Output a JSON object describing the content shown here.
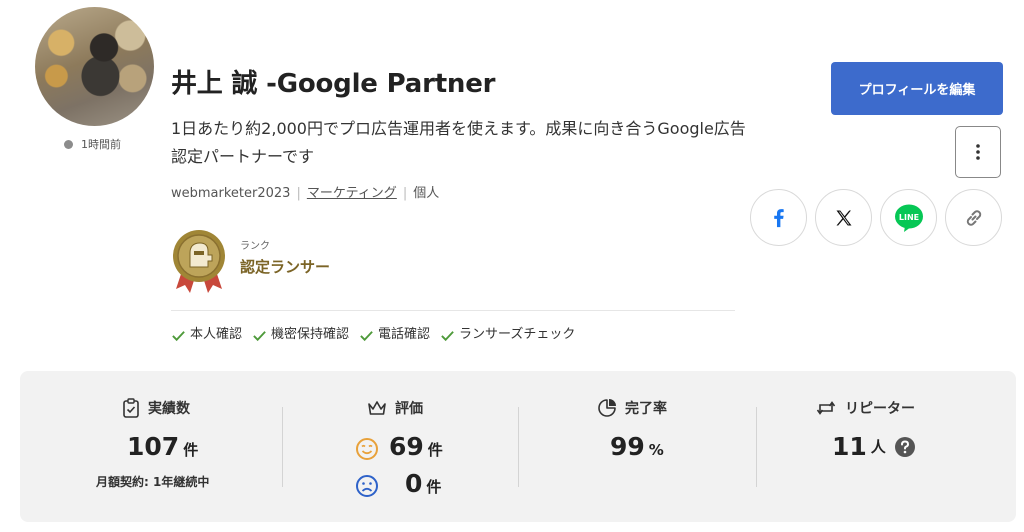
{
  "profile": {
    "name_title": "井上 誠 -Google Partner",
    "catchphrase": "1日あたり約2,000円でプロ広告運用者を使えます。成果に向き合うGoogle広告認定パートナーです",
    "last_login": "1時間前",
    "username": "webmarketer2023",
    "category": "マーケティング",
    "account_type": "個人",
    "rank_label": "ランク",
    "rank_value": "認定ランサー",
    "verifications": [
      "本人確認",
      "機密保持確認",
      "電話確認",
      "ランサーズチェック"
    ]
  },
  "actions": {
    "edit_label": "プロフィールを編集",
    "share_icons": [
      "facebook-icon",
      "x-icon",
      "line-icon",
      "link-icon"
    ],
    "line_text": "LINE"
  },
  "stats": {
    "achievements_label": "実績数",
    "achievements_value": "107",
    "achievements_unit": "件",
    "achievements_sub": "月額契約: 1年継続中",
    "rating_label": "評価",
    "rating_good": "69",
    "rating_bad": "0",
    "rating_unit": "件",
    "completion_label": "完了率",
    "completion_value": "99",
    "completion_unit": "%",
    "repeater_label": "リピーター",
    "repeater_value": "11",
    "repeater_unit": "人"
  },
  "colors": {
    "accent": "#3d6bcc",
    "check": "#4e9a3a",
    "rank_gold": "#7b6426",
    "facebook": "#1877f2",
    "line": "#06c755",
    "good_face": "#e8a13a",
    "bad_face": "#2e62c9"
  }
}
